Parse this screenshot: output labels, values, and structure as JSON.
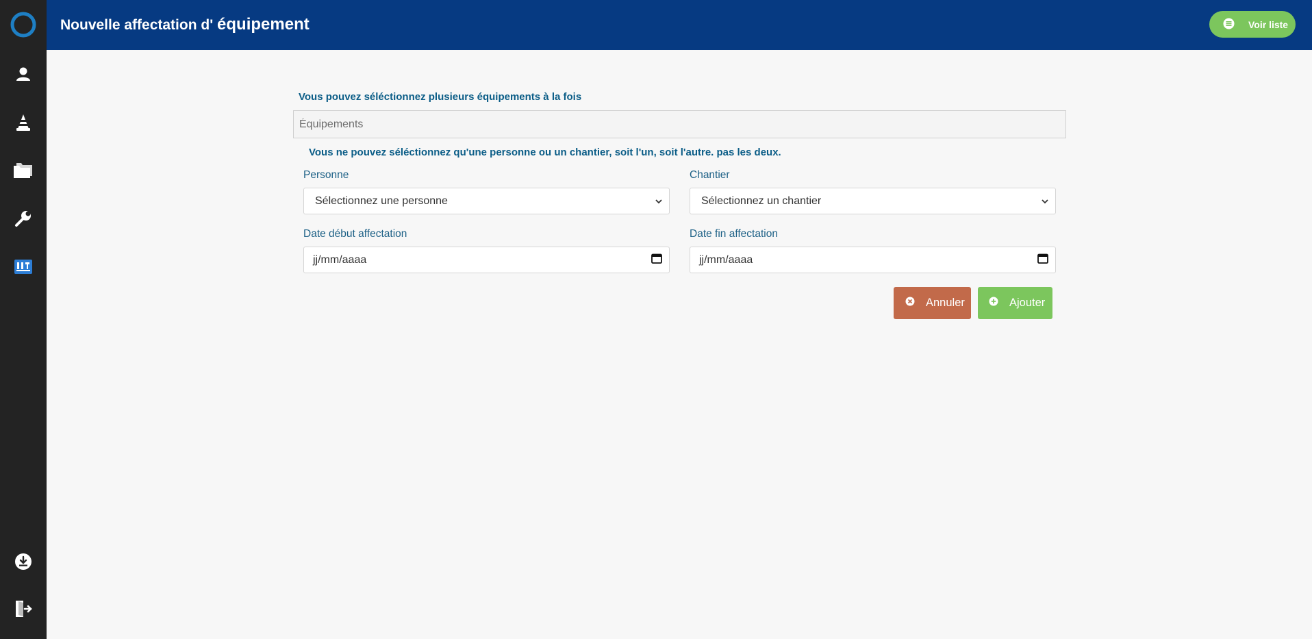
{
  "header": {
    "title_prefix": "Nouvelle affectation d'",
    "title_strong": "équipement",
    "list_button": "Voir liste"
  },
  "sidebar": {
    "items": [
      {
        "icon": "logo-ring-icon"
      },
      {
        "icon": "user-icon"
      },
      {
        "icon": "cone-icon"
      },
      {
        "icon": "folder-icon"
      },
      {
        "icon": "wrench-icon"
      },
      {
        "icon": "equipment-icon"
      },
      {
        "icon": "download-icon"
      },
      {
        "icon": "logout-icon"
      }
    ]
  },
  "form": {
    "multi_info": "Vous pouvez séléctionnez plusieurs équipements à la fois",
    "equipment_placeholder": "Équipements",
    "exclusive_info": "Vous ne pouvez séléctionnez qu'une personne ou un chantier, soit l'un, soit l'autre. pas les deux.",
    "person_label": "Personne",
    "person_value": "Sélectionnez une personne",
    "site_label": "Chantier",
    "site_value": "Sélectionnez un chantier",
    "start_label": "Date début affectation",
    "start_value": "jj/mm/aaaa",
    "end_label": "Date fin affectation",
    "end_value": "jj/mm/aaaa",
    "cancel_button": "Annuler",
    "add_button": "Ajouter"
  },
  "colors": {
    "header": "#063a82",
    "sidebar": "#232323",
    "success": "#7cc65d",
    "cancel": "#c26a4a",
    "info_text": "#0b5d87"
  }
}
